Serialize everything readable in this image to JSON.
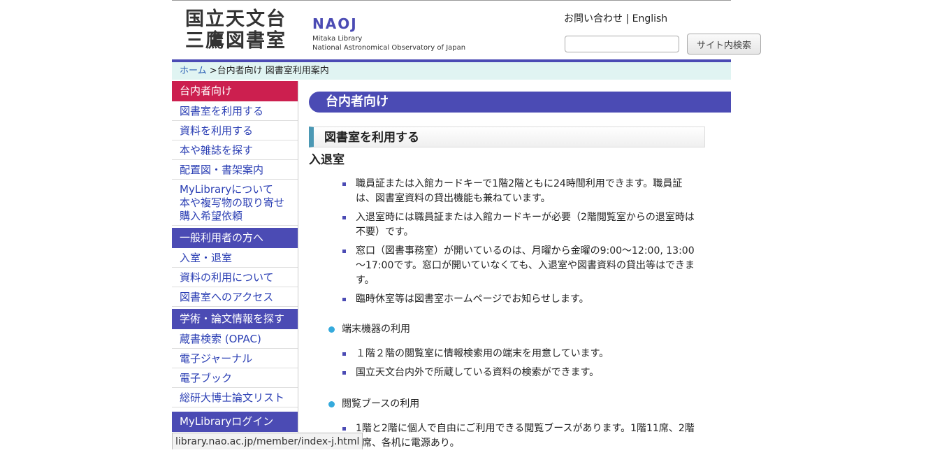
{
  "header": {
    "logo_jp_line1": "国立天文台",
    "logo_jp_line2": "三鷹図書室",
    "logo_naoj": "NAOJ",
    "logo_en_line1": "Mitaka Library",
    "logo_en_line2": "National Astronomical Observatory of Japan",
    "contact_link": "お問い合わせ",
    "separator": " | ",
    "english_link": "English",
    "search_placeholder": "",
    "search_button": "サイト内検索"
  },
  "breadcrumb": {
    "home": "ホーム",
    "current": " >台内者向け 図書室利用案内"
  },
  "sidebar": {
    "sections": [
      {
        "title": "台内者向け",
        "color": "#cc1f4f",
        "items": [
          "図書室を利用する",
          "資料を利用する",
          "本や雑誌を探す",
          "配置図・書架案内"
        ],
        "multi": [
          "MyLibraryについて",
          "本や複写物の取り寄せ",
          "購入希望依頼"
        ]
      },
      {
        "title": "一般利用者の方へ",
        "color": "#4b4bb4",
        "items": [
          "入室・退室",
          "資料の利用について",
          "図書室へのアクセス"
        ]
      },
      {
        "title": "学術・論文情報を探す",
        "color": "#4b4bb4",
        "items": [
          "蔵書検索 (OPAC)",
          "電子ジャーナル",
          "電子ブック",
          "総研大博士論文リスト"
        ]
      },
      {
        "title": "MyLibraryログイン",
        "color": "#4b4bb4",
        "items": []
      }
    ]
  },
  "content": {
    "h1": "台内者向け",
    "h2": "図書室を利用する",
    "h3": "入退室",
    "entry_items": [
      "職員証または入館カードキーで1階2階ともに24時間利用できます。職員証は、図書室資料の貸出機能も兼ねています。",
      "入退室時には職員証または入館カードキーが必要（2階閲覧室からの退室時は不要）です。",
      "窓口（図書事務室）が開いているのは、月曜から金曜の9:00～12:00, 13:00～17:00です。窓口が開いていなくても、入退室や図書資料の貸出等はできます。",
      "臨時休室等は図書室ホームページでお知らせします。"
    ],
    "terminal_heading": "端末機器の利用",
    "terminal_items": [
      "１階２階の閲覧室に情報検索用の端末を用意しています。",
      "国立天文台内外で所蔵している資料の検索ができます。"
    ],
    "booth_heading": "閲覧ブースの利用",
    "booth_items": [
      "1階と2階に個人で自由にご利用できる閲覧ブースがあります。1階11席、2階8席、各机に電源あり。"
    ]
  },
  "status_bar": {
    "url": "library.nao.ac.jp/member/index-j.html"
  }
}
